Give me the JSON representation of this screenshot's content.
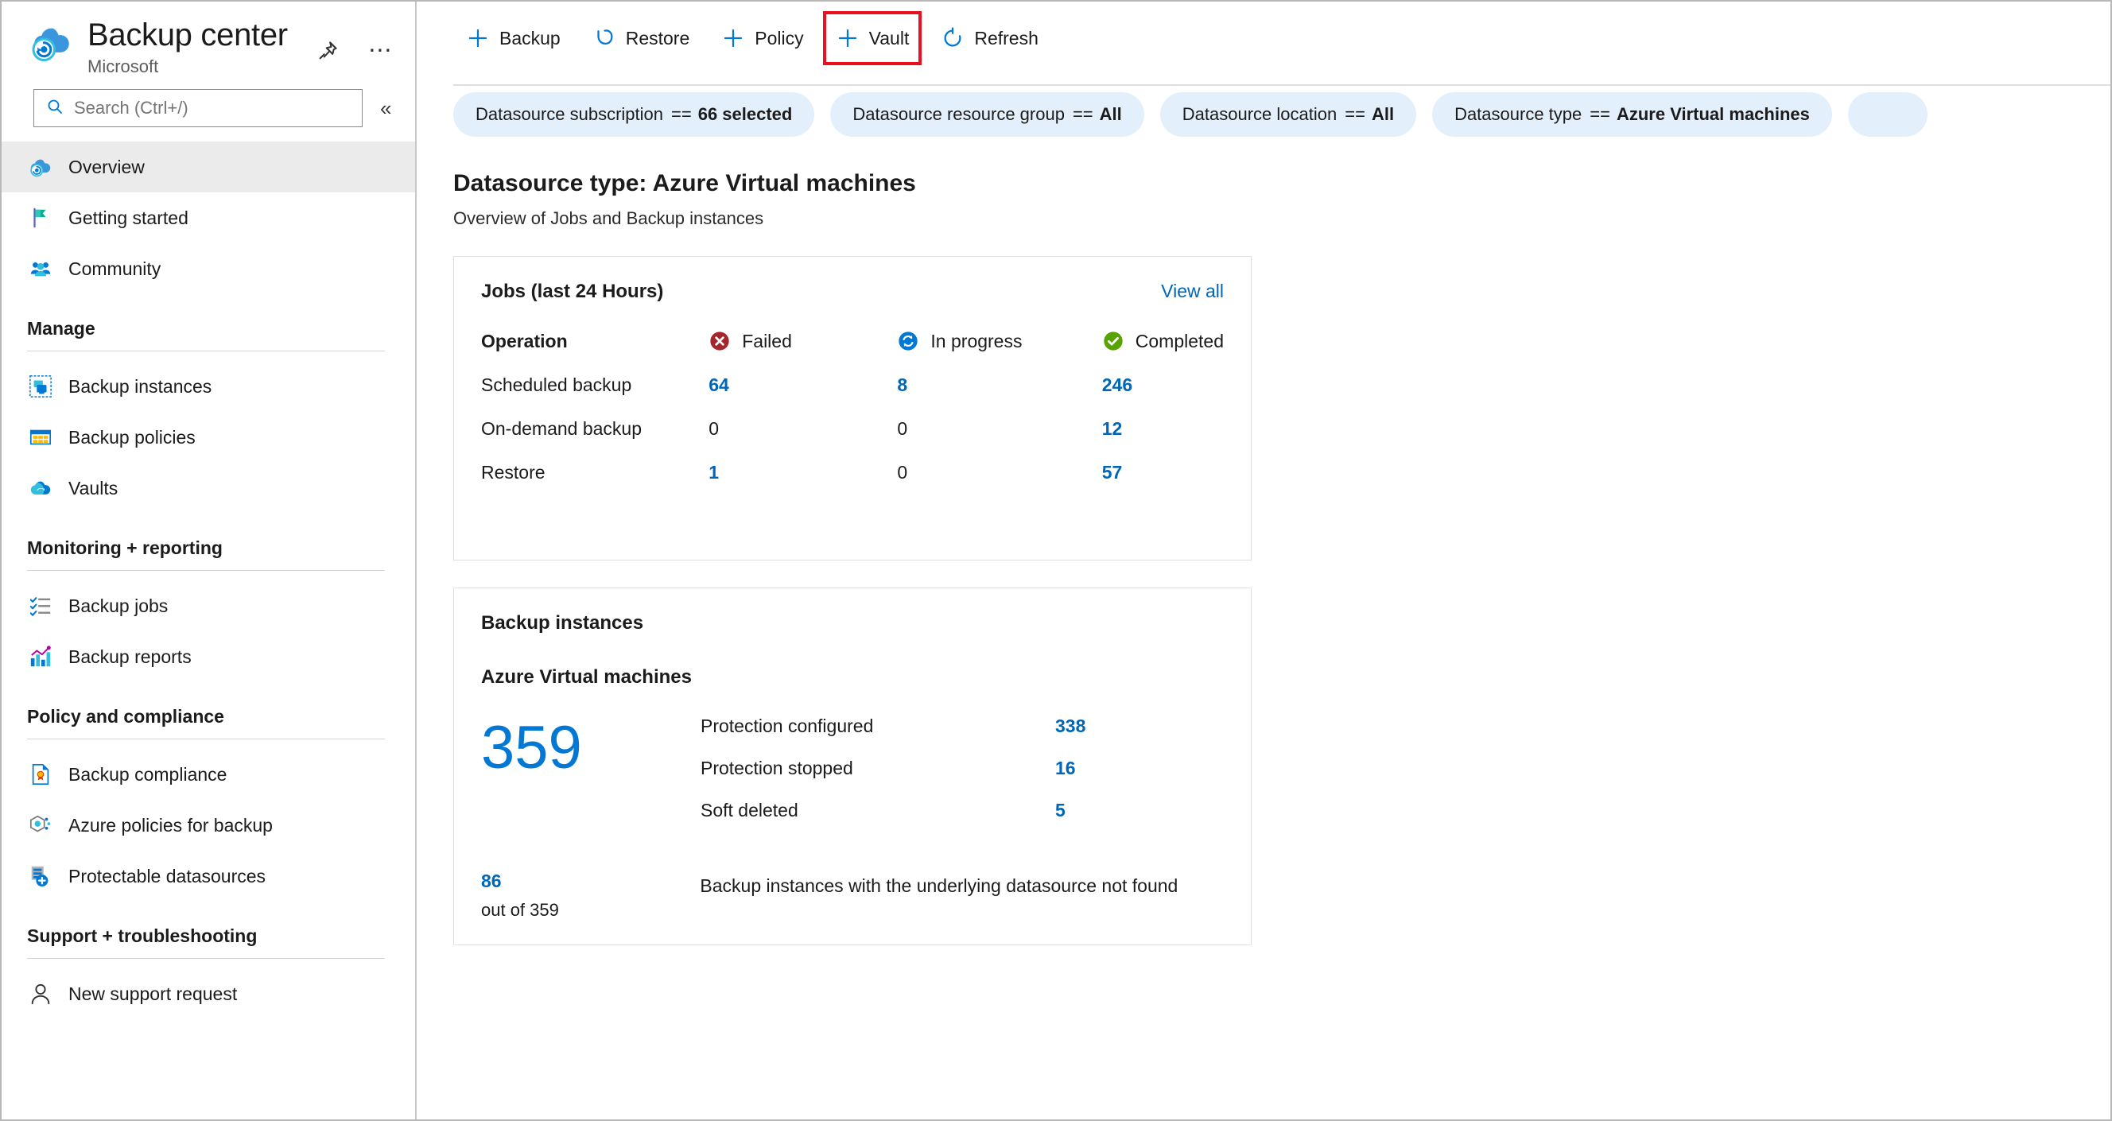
{
  "brand": {
    "title": "Backup center",
    "subtitle": "Microsoft",
    "pin_icon": "pin-icon",
    "more_icon": "ellipsis-icon"
  },
  "search": {
    "placeholder": "Search (Ctrl+/)",
    "value": "",
    "icon": "search-icon",
    "collapse_label": "«"
  },
  "sidebar": {
    "items": [
      {
        "label": "Overview",
        "icon": "backup-center-icon",
        "active": true
      },
      {
        "label": "Getting started",
        "icon": "flag-icon",
        "active": false
      },
      {
        "label": "Community",
        "icon": "people-icon",
        "active": false
      }
    ],
    "groups": [
      {
        "title": "Manage",
        "items": [
          {
            "label": "Backup instances",
            "icon": "backup-instance-icon"
          },
          {
            "label": "Backup policies",
            "icon": "policy-grid-icon"
          },
          {
            "label": "Vaults",
            "icon": "vault-cloud-icon"
          }
        ]
      },
      {
        "title": "Monitoring + reporting",
        "items": [
          {
            "label": "Backup jobs",
            "icon": "checklist-icon"
          },
          {
            "label": "Backup reports",
            "icon": "bar-chart-icon"
          }
        ]
      },
      {
        "title": "Policy and compliance",
        "items": [
          {
            "label": "Backup compliance",
            "icon": "compliance-doc-icon"
          },
          {
            "label": "Azure policies for backup",
            "icon": "azure-policy-icon"
          },
          {
            "label": "Protectable datasources",
            "icon": "protectable-datasource-icon"
          }
        ]
      },
      {
        "title": "Support + troubleshooting",
        "items": [
          {
            "label": "New support request",
            "icon": "person-support-icon"
          }
        ]
      }
    ]
  },
  "toolbar": {
    "buttons": [
      {
        "label": "Backup",
        "icon": "plus-icon",
        "highlighted": false
      },
      {
        "label": "Restore",
        "icon": "undo-arrow-icon",
        "highlighted": false
      },
      {
        "label": "Policy",
        "icon": "plus-icon",
        "highlighted": false
      },
      {
        "label": "Vault",
        "icon": "plus-icon",
        "highlighted": true
      },
      {
        "label": "Refresh",
        "icon": "refresh-icon",
        "highlighted": false
      }
    ]
  },
  "filters": [
    {
      "name": "Datasource subscription",
      "operator": "==",
      "value": "66 selected"
    },
    {
      "name": "Datasource resource group",
      "operator": "==",
      "value": "All"
    },
    {
      "name": "Datasource location",
      "operator": "==",
      "value": "All"
    },
    {
      "name": "Datasource type",
      "operator": "==",
      "value": "Azure Virtual machines"
    }
  ],
  "main": {
    "page_title": "Datasource type: Azure Virtual machines",
    "page_subtitle": "Overview of Jobs and Backup instances"
  },
  "jobs_card": {
    "title": "Jobs (last 24 Hours)",
    "view_all_label": "View all",
    "columns": [
      {
        "label": "Operation",
        "icon": null
      },
      {
        "label": "Failed",
        "icon": "error-circle-icon"
      },
      {
        "label": "In progress",
        "icon": "sync-circle-icon"
      },
      {
        "label": "Completed",
        "icon": "success-circle-icon"
      }
    ],
    "rows": [
      {
        "operation": "Scheduled backup",
        "failed": "64",
        "in_progress": "8",
        "completed": "246"
      },
      {
        "operation": "On-demand backup",
        "failed": "0",
        "in_progress": "0",
        "completed": "12"
      },
      {
        "operation": "Restore",
        "failed": "1",
        "in_progress": "0",
        "completed": "57"
      }
    ]
  },
  "instances_card": {
    "title": "Backup instances",
    "subtitle": "Azure Virtual machines",
    "total": "359",
    "rows": [
      {
        "label": "Protection configured",
        "value": "338"
      },
      {
        "label": "Protection stopped",
        "value": "16"
      },
      {
        "label": "Soft deleted",
        "value": "5"
      }
    ],
    "footer": {
      "count": "86",
      "out_of": "out of 359",
      "description": "Backup instances with the underlying datasource not found"
    }
  },
  "colors": {
    "accent_blue": "#0078d4",
    "link_blue": "#0067b8",
    "pill_bg": "#e3effb",
    "highlight_red": "#e81123",
    "failed_red": "#a4262c",
    "completed_green": "#57a300",
    "inprogress_blue": "#0078d4"
  }
}
